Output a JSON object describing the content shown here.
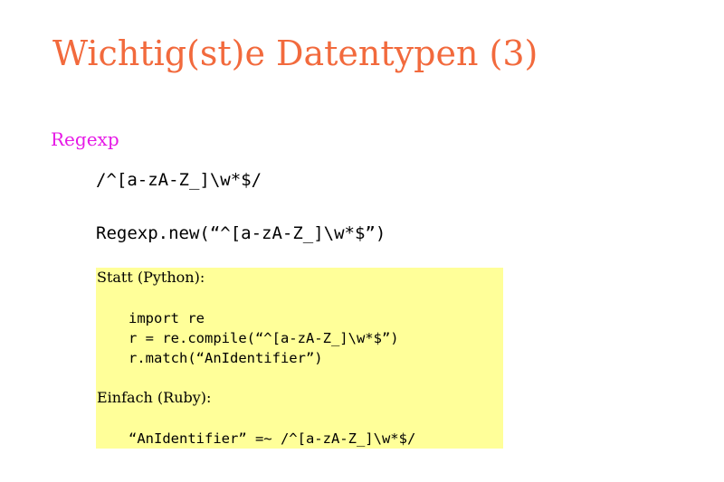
{
  "slide": {
    "title": "Wichtig(st)e Datentypen (3)",
    "section_label": "Regexp",
    "lines": [
      "/^[a-zA-Z_]\\w*$/",
      "Regexp.new(“^[a-zA-Z_]\\w*$”)"
    ],
    "box": {
      "python_heading": "Statt (Python):",
      "python_code": [
        "import re",
        "r = re.compile(“^[a-zA-Z_]\\w*$”)",
        "r.match(“AnIdentifier”)"
      ],
      "ruby_heading": "Einfach (Ruby):",
      "ruby_code": "“AnIdentifier” =~ /^[a-zA-Z_]\\w*$/"
    }
  },
  "colors": {
    "title": "#f26a3d",
    "section_label": "#e619e6",
    "box_background": "#ffff99"
  }
}
